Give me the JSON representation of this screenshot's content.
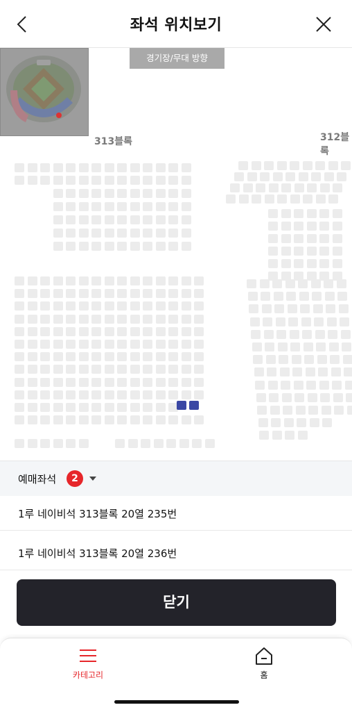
{
  "header": {
    "title": "좌석 위치보기",
    "back_icon": "back-chevron-icon",
    "close_icon": "close-x-icon"
  },
  "seat_map": {
    "direction_label": "경기장/무대 방향",
    "block_labels": [
      "313블록",
      "312블록"
    ],
    "available_color": "#ececec",
    "selected_color": "#3a47a4"
  },
  "reserved": {
    "label": "예매좌석",
    "count": "2"
  },
  "seats": [
    "1루 네이비석 313블록 20열 235번",
    "1루 네이비석 313블록 20열 236번"
  ],
  "close_button": "닫기",
  "tabbar": {
    "items": [
      {
        "label": "카테고리",
        "icon": "menu-icon",
        "active": true,
        "color": "#e6262a"
      },
      {
        "label": "홈",
        "icon": "home-icon",
        "active": false,
        "color": "#111111"
      }
    ]
  }
}
